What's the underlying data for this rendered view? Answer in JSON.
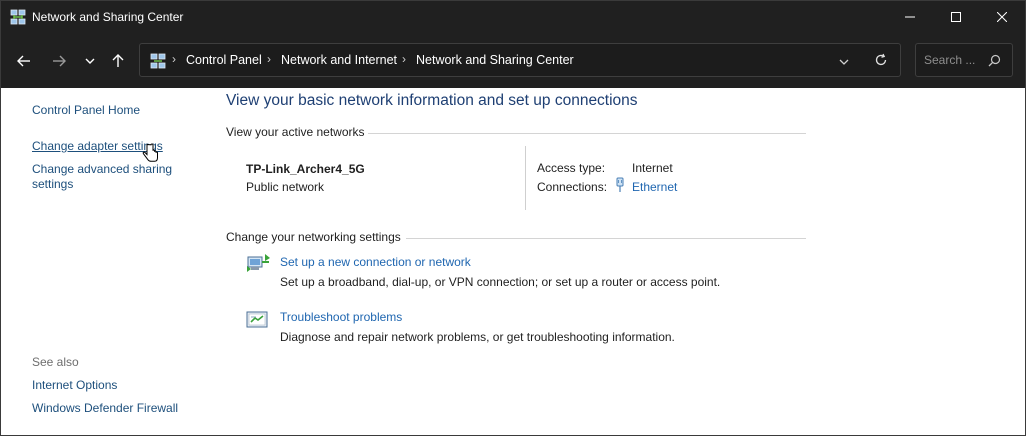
{
  "window": {
    "title": "Network and Sharing Center"
  },
  "address_bar": {
    "crumbs": [
      "Control Panel",
      "Network and Internet",
      "Network and Sharing Center"
    ],
    "search_placeholder": "Search ..."
  },
  "sidebar": {
    "home": "Control Panel Home",
    "links": [
      "Change adapter settings",
      "Change advanced sharing",
      "settings"
    ],
    "see_also_label": "See also",
    "see_also": [
      "Internet Options",
      "Windows Defender Firewall"
    ]
  },
  "main": {
    "title": "View your basic network information and set up connections",
    "active_networks_header": "View your active networks",
    "network_name": "TP-Link_Archer4_5G",
    "network_type": "Public network",
    "access_type_label": "Access type:",
    "access_type_value": "Internet",
    "connections_label": "Connections:",
    "connections_value": "Ethernet",
    "change_settings_header": "Change your networking settings",
    "tasks": [
      {
        "icon": "network-setup-icon",
        "link": "Set up a new connection or network",
        "desc": "Set up a broadband, dial-up, or VPN connection; or set up a router or access point."
      },
      {
        "icon": "troubleshoot-icon",
        "link": "Troubleshoot problems",
        "desc": "Diagnose and repair network problems, or get troubleshooting information."
      }
    ]
  },
  "colors": {
    "titlebar_bg": "#202020",
    "link": "#1f66b0",
    "heading": "#1e3f73"
  }
}
